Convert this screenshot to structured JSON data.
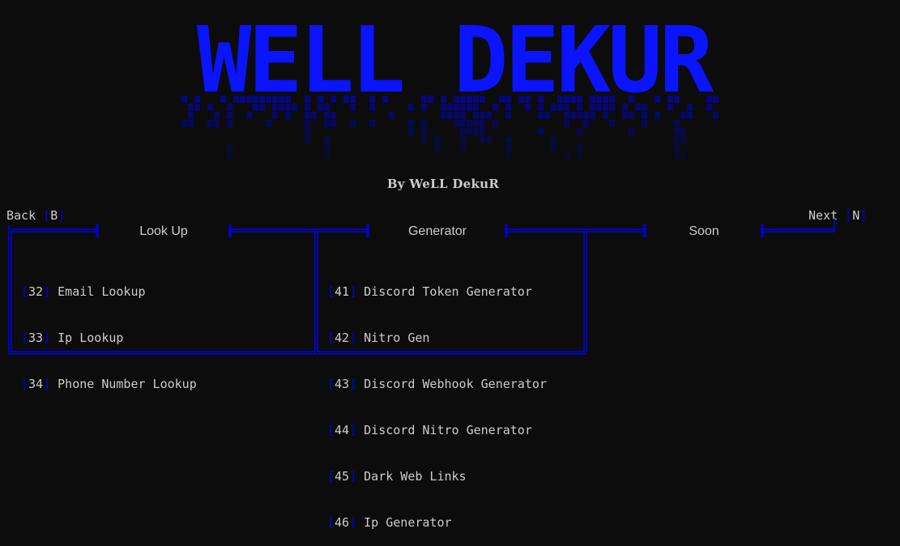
{
  "banner": {
    "art_text": "WELL DEKUR",
    "color": "#0000ee"
  },
  "subtitle": "By WeLL DekuR",
  "nav": {
    "back": {
      "label": "Back",
      "key": "B"
    },
    "next": {
      "label": "Next",
      "key": "N"
    }
  },
  "columns": [
    {
      "header": "Look Up"
    },
    {
      "header": "Generator"
    },
    {
      "header": "Soon"
    }
  ],
  "lookup_items": [
    {
      "num": "32",
      "label": "Email Lookup"
    },
    {
      "num": "33",
      "label": "Ip Lookup"
    },
    {
      "num": "34",
      "label": "Phone Number Lookup"
    }
  ],
  "generator_items": [
    {
      "num": "41",
      "label": "Discord Token Generator"
    },
    {
      "num": "42",
      "label": "Nitro Gen"
    },
    {
      "num": "43",
      "label": "Discord Webhook Generator"
    },
    {
      "num": "44",
      "label": "Discord Nitro Generator"
    },
    {
      "num": "45",
      "label": "Dark Web Links"
    },
    {
      "num": "46",
      "label": "Ip Generator"
    }
  ],
  "colors": {
    "background": "#0c0c0c",
    "text": "#cccccc",
    "accent_blue": "#0000ee"
  }
}
